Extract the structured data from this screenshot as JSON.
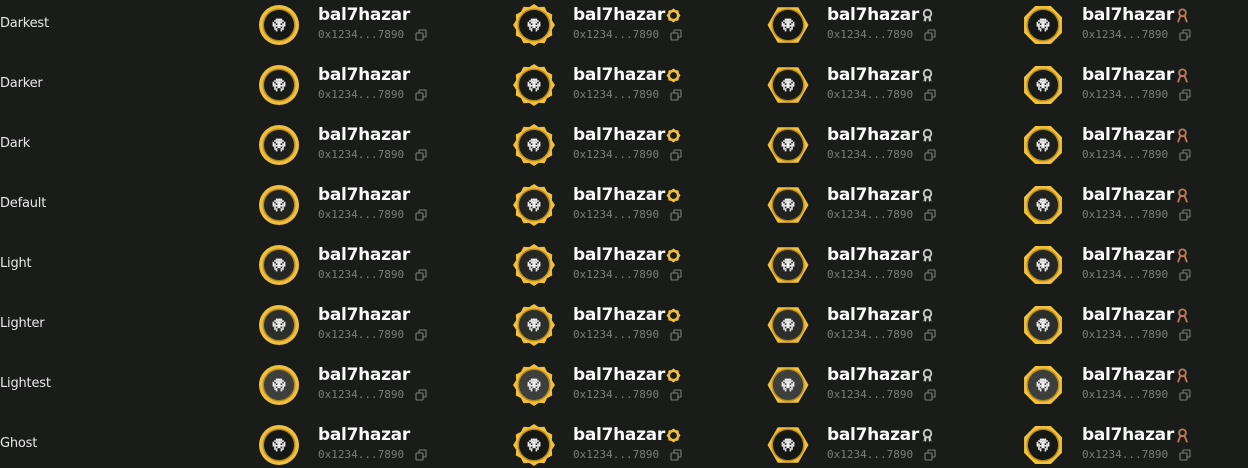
{
  "user": {
    "name": "bal7hazar",
    "address": "0x1234...7890"
  },
  "colors": {
    "background": "#1a1c1a",
    "avatar_ring": "#f0bf3d",
    "avatar_ring_dark": "#b58a1d",
    "badge_gold": "#f0bf3d",
    "badge_silver": "#c9c9c9",
    "badge_bronze": "#c27b5e",
    "address": "#7c7e7b"
  },
  "variants": [
    {
      "label": "Darkest",
      "avatar_fill": "#161816"
    },
    {
      "label": "Darker",
      "avatar_fill": "#191b19"
    },
    {
      "label": "Dark",
      "avatar_fill": "#1d1f1d"
    },
    {
      "label": "Default",
      "avatar_fill": "#212321"
    },
    {
      "label": "Light",
      "avatar_fill": "#252725"
    },
    {
      "label": "Lighter",
      "avatar_fill": "#2c2e2c"
    },
    {
      "label": "Lightest",
      "avatar_fill": "#3d3f3d"
    },
    {
      "label": "Ghost",
      "avatar_fill": "#161816"
    }
  ],
  "columns": [
    {
      "frame": "circle",
      "badge": null,
      "badge_icon": null
    },
    {
      "frame": "gear",
      "badge": "gold",
      "badge_icon": "gold-badge-icon"
    },
    {
      "frame": "hexagon",
      "badge": "silver",
      "badge_icon": "silver-medal-icon"
    },
    {
      "frame": "octagon",
      "badge": "bronze",
      "badge_icon": "bronze-ribbon-icon"
    }
  ]
}
